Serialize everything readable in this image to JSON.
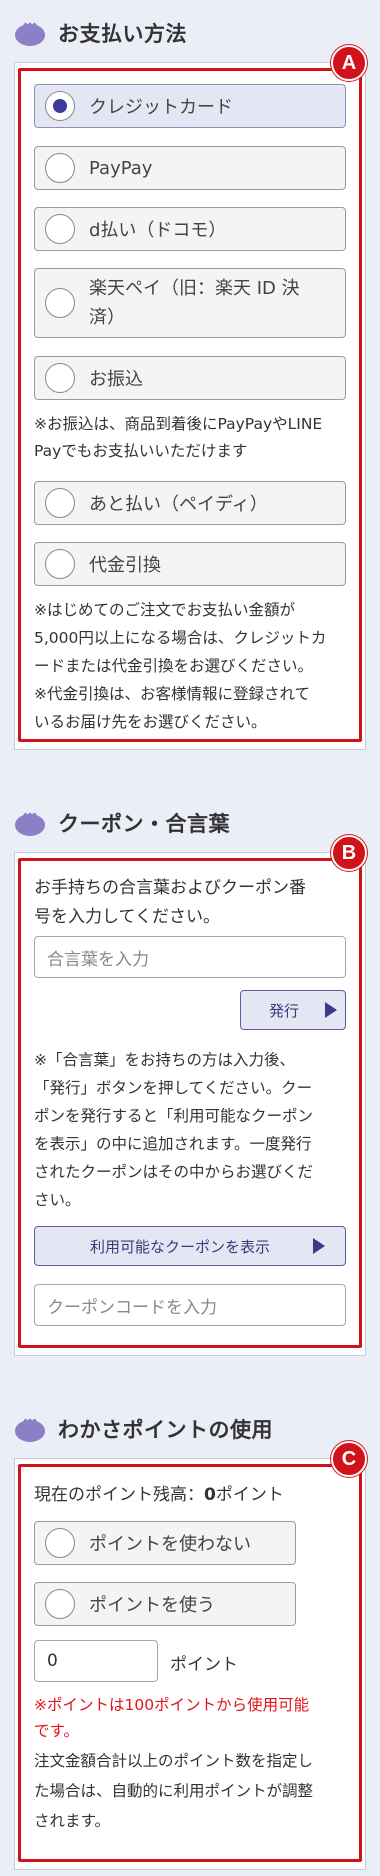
{
  "payment": {
    "title": "お支払い方法",
    "badge": "A",
    "options": [
      {
        "label": "クレジットカード"
      },
      {
        "label": "PayPay"
      },
      {
        "label": "d払い（ドコモ）"
      },
      {
        "label_line1": "楽天ペイ（旧：楽天 ID 決",
        "label_line2": "済）"
      },
      {
        "label": "お振込"
      },
      {
        "label": "あと払い（ペイディ）"
      },
      {
        "label": "代金引換"
      }
    ],
    "selected_index": 0,
    "transfer_note_line1": "※お振込は、商品到着後にPayPayやLINE",
    "transfer_note_line2": "Payでもお支払いいただけます",
    "cod_note": [
      "※はじめてのご注文でお支払い金額が",
      "5,000円以上になる場合は、クレジットカ",
      "ードまたは代金引換をお選びください。",
      "※代金引換は、お客様情報に登録されて",
      "いるお届け先をお選びください。"
    ]
  },
  "coupon": {
    "title": "クーポン・合言葉",
    "badge": "B",
    "intro_line1": "お手持ちの合言葉およびクーポン番",
    "intro_line2": "号を入力してください。",
    "keyword_placeholder": "合言葉を入力",
    "issue_button": "発行",
    "note": [
      "※「合言葉」をお持ちの方は入力後、",
      "「発行」ボタンを押してください。クー",
      "ポンを発行すると「利用可能なクーポン",
      "を表示」の中に追加されます。一度発行",
      "されたクーポンはその中からお選びくだ",
      "さい。"
    ],
    "show_coupons_button": "利用可能なクーポンを表示",
    "code_placeholder": "クーポンコードを入力"
  },
  "points": {
    "title": "わかさポイントの使用",
    "badge": "C",
    "balance_label": "現在のポイント残高：",
    "balance_value": "0",
    "balance_unit": "ポイント",
    "options": [
      {
        "label": "ポイントを使わない"
      },
      {
        "label": "ポイントを使う"
      }
    ],
    "input_value": "0",
    "input_unit": "ポイント",
    "min_note_line1": "※ポイントは100ポイントから使用可能",
    "min_note_line2": "です。",
    "adjust_note": [
      "注文金額合計以上のポイント数を指定し",
      "た場合は、自動的に利用ポイントが調整",
      "されます。"
    ]
  },
  "colors": {
    "accent_purple": "#7a6bbf",
    "badge_red": "#d0121b",
    "warning_red": "#e0141e"
  }
}
